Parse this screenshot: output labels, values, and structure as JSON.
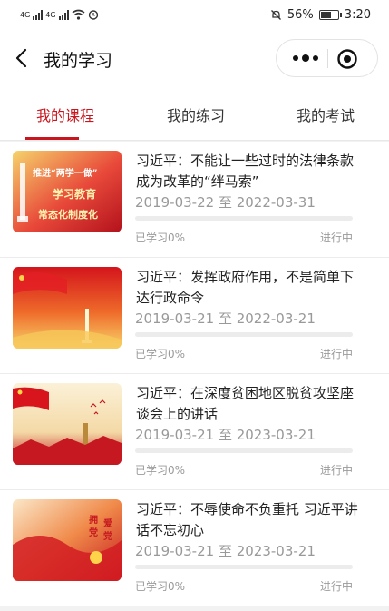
{
  "status_bar": {
    "signal1": "4G",
    "signal2": "4G",
    "battery": "56%",
    "time": "3:20"
  },
  "nav": {
    "title": "我的学习",
    "icons": {
      "back": "chevron-left-icon",
      "more": "more-dots-icon",
      "close": "target-circle-icon"
    }
  },
  "tabs": [
    {
      "label": "我的课程",
      "active": true
    },
    {
      "label": "我的练习",
      "active": false
    },
    {
      "label": "我的考试",
      "active": false
    }
  ],
  "courses": [
    {
      "title": "习近平：不能让一些过时的法律条款成为改革的“绊马索”",
      "date_range": "2019-03-22 至 2022-03-31",
      "progress_label": "已学习0%",
      "progress": 0,
      "status": "进行中",
      "thumb_text": [
        "推进“两学一做”",
        "学习教育",
        "常态化制度化"
      ]
    },
    {
      "title": "习近平：发挥政府作用，不是简单下达行政命令",
      "date_range": "2019-03-21 至 2022-03-21",
      "progress_label": "已学习0%",
      "progress": 0,
      "status": "进行中"
    },
    {
      "title": "习近平：在深度贫困地区脱贫攻坚座谈会上的讲话",
      "date_range": "2019-03-21 至 2023-03-21",
      "progress_label": "已学习0%",
      "progress": 0,
      "status": "进行中"
    },
    {
      "title": "习近平：不辱使命不负重托 习近平讲话不忘初心",
      "date_range": "2019-03-21 至 2023-03-21",
      "progress_label": "已学习0%",
      "progress": 0,
      "status": "进行中",
      "thumb_text": [
        "拥",
        "党",
        "爱",
        "党"
      ]
    }
  ],
  "colors": {
    "accent": "#c9151e",
    "muted": "#999999",
    "track": "#ececec"
  }
}
